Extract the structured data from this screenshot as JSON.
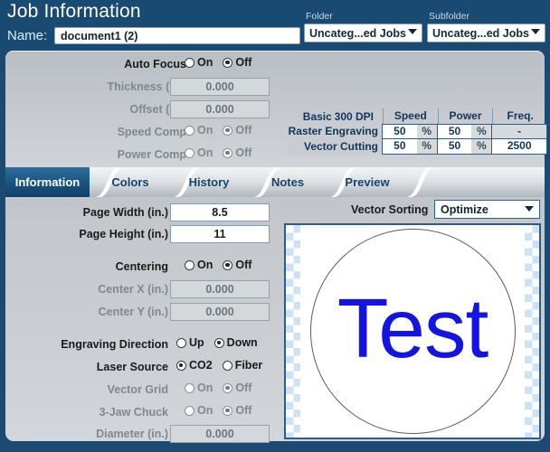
{
  "header": {
    "title": "Job Information",
    "name_label": "Name:",
    "name_value": "document1 (2)",
    "folder_caption": "Folder",
    "folder_value": "Uncateg...ed Jobs",
    "subfolder_caption": "Subfolder",
    "subfolder_value": "Uncateg...ed Jobs"
  },
  "focus_panel": {
    "auto_focus_label": "Auto Focus",
    "auto_focus_on": "On",
    "auto_focus_off": "Off",
    "thickness_label": "Thickness (in.)",
    "thickness_value": "0.000",
    "offset_label": "Offset (in.)",
    "offset_value": "0.000",
    "speed_comp_label": "Speed Comp",
    "speed_comp_on": "On",
    "speed_comp_off": "Off",
    "power_comp_label": "Power Comp",
    "power_comp_on": "On",
    "power_comp_off": "Off"
  },
  "settings_table": {
    "mode": "Basic",
    "dpi": "300 DPI",
    "col_speed": "Speed",
    "col_power": "Power",
    "col_freq": "Freq.",
    "rows": [
      {
        "name": "Raster Engraving",
        "speed": "50",
        "speed_unit": "%",
        "power": "50",
        "power_unit": "%",
        "freq": "-"
      },
      {
        "name": "Vector Cutting",
        "speed": "50",
        "speed_unit": "%",
        "power": "50",
        "power_unit": "%",
        "freq": "2500"
      }
    ]
  },
  "slider": {
    "value": 50
  },
  "tabs": [
    {
      "label": "Information",
      "active": true
    },
    {
      "label": "Colors",
      "active": false
    },
    {
      "label": "History",
      "active": false
    },
    {
      "label": "Notes",
      "active": false
    },
    {
      "label": "Preview",
      "active": false
    }
  ],
  "information": {
    "page_width_label": "Page Width (in.)",
    "page_width_value": "8.5",
    "page_height_label": "Page Height (in.)",
    "page_height_value": "11",
    "centering_label": "Centering",
    "centering_on": "On",
    "centering_off": "Off",
    "center_x_label": "Center X (in.)",
    "center_x_value": "0.000",
    "center_y_label": "Center Y (in.)",
    "center_y_value": "0.000",
    "engraving_direction_label": "Engraving Direction",
    "engraving_up": "Up",
    "engraving_down": "Down",
    "laser_source_label": "Laser Source",
    "laser_co2": "CO2",
    "laser_fiber": "Fiber",
    "vector_grid_label": "Vector Grid",
    "vector_grid_on": "On",
    "vector_grid_off": "Off",
    "chuck_label": "3-Jaw Chuck",
    "chuck_on": "On",
    "chuck_off": "Off",
    "diameter_label": "Diameter (in.)",
    "diameter_value": "0.000"
  },
  "vector_sorting": {
    "label": "Vector Sorting",
    "value": "Optimize"
  },
  "preview": {
    "artwork_text": "Test",
    "artwork_color": "#1414e0"
  },
  "colors": {
    "header_blue": "#194a72",
    "panel_gray": "#c6cacf",
    "tab_active": "#1c5884",
    "field_border": "#7f9db9"
  }
}
